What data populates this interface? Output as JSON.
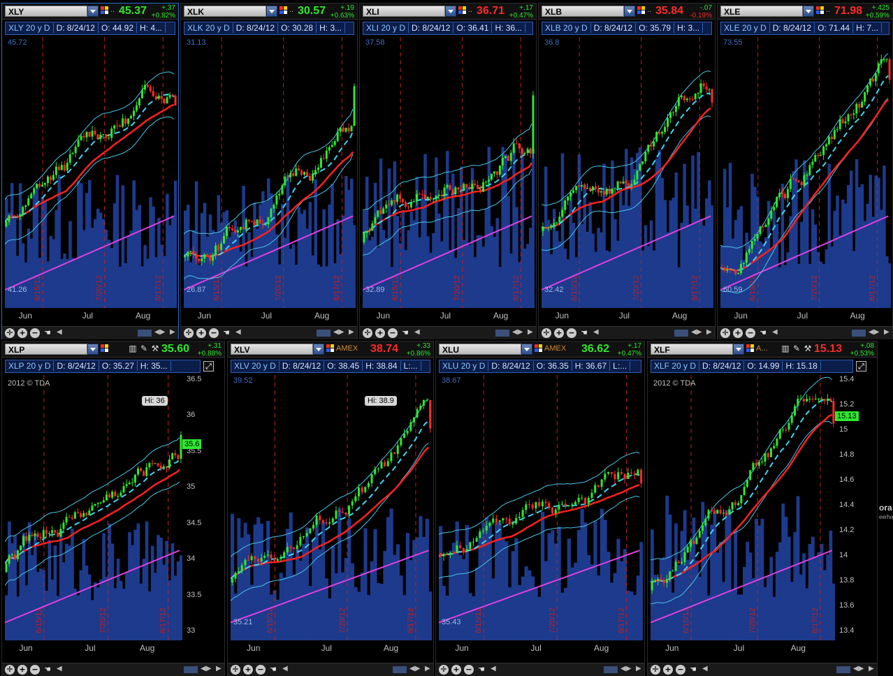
{
  "colors": {
    "up": "#2ee82e",
    "down": "#ff2a2a",
    "bb": "#49c6e6",
    "mid": "#3fd6f0",
    "sma": "#ff2020",
    "long": "#e040e0",
    "vol": "#1d3a8c",
    "grid": "#7a1010"
  },
  "panels": [
    {
      "symbol": "XLY",
      "price": "45.37",
      "chg": "+.37",
      "pct": "+0.82%",
      "dir": "up",
      "study": "XLY 20 y D",
      "d": "D: 8/24/12",
      "o": "O: 44.92",
      "h": "H: 4...",
      "top": "45.72",
      "bottom": "41.26",
      "dates": [
        "6/15/12",
        "7/20/12",
        "8/17/12"
      ],
      "months": [
        "Jun",
        "Jul",
        "Aug"
      ],
      "start": 43.3,
      "end": 45.37,
      "vol": 0.35
    },
    {
      "symbol": "XLK",
      "price": "30.57",
      "chg": "+.19",
      "pct": "+0.63%",
      "dir": "up",
      "study": "XLK 20 y D",
      "d": "D: 8/24/12",
      "o": "O: 30.28",
      "h": "H: 3...",
      "top": "31.13",
      "bottom": "26.87",
      "dates": [
        "6/15/12",
        "7/20/12",
        "8/17/12"
      ],
      "months": [
        "Jun",
        "Jul",
        "Aug"
      ],
      "start": 27.5,
      "end": 30.57,
      "vol": 0.35
    },
    {
      "symbol": "XLI",
      "price": "36.71",
      "chg": "+.17",
      "pct": "+0.47%",
      "dir": "dn",
      "study": "XLI 20 y D",
      "d": "D: 8/24/12",
      "o": "O: 36.41",
      "h": "H: 36...",
      "top": "37.58",
      "bottom": "32.89",
      "dates": [
        "6/15/12",
        "7/20/12",
        "8/17/12"
      ],
      "months": [
        "Jun",
        "Jul",
        "Aug"
      ],
      "start": 34.2,
      "end": 36.71,
      "vol": 0.45
    },
    {
      "symbol": "XLB",
      "price": "35.84",
      "chg": "-.07",
      "pct": "-0.19%",
      "dir": "dn",
      "study": "XLB 20 y D",
      "d": "D: 8/24/12",
      "o": "O: 35.79",
      "h": "H: 3...",
      "top": "36.8",
      "bottom": "32.42",
      "dates": [
        "6/15/12",
        "7/20/12",
        "8/17/12"
      ],
      "months": [
        "Jun",
        "Jul",
        "Aug"
      ],
      "start": 34.0,
      "end": 35.84,
      "vol": 0.45
    },
    {
      "symbol": "XLE",
      "price": "71.98",
      "chg": "+.425",
      "pct": "+0.59%",
      "dir": "dn",
      "study": "XLE 20 y D",
      "d": "D: 8/24/12",
      "o": "O: 71.44",
      "h": "H: 7...",
      "top": "73.55",
      "bottom": "60.59",
      "dates": [
        "6/15/12",
        "7/20/12",
        "8/17/12"
      ],
      "months": [
        "Jun",
        "Jul",
        "Aug"
      ],
      "start": 62.0,
      "end": 71.98,
      "vol": 0.4
    },
    {
      "symbol": "XLP",
      "exch": "",
      "price": "35.60",
      "chg": "+.31",
      "pct": "+0.88%",
      "dir": "up",
      "study": "XLP 20 y D",
      "d": "D: 8/24/12",
      "o": "O: 35.27",
      "h": "H: 35...",
      "copyright": "2012 © TDA",
      "hi": "Hi: 36",
      "tag": "35.6",
      "yticks": [
        "36.5",
        "36",
        "35.5",
        "35",
        "34.5",
        "34",
        "33.5",
        "33"
      ],
      "dates": [
        "6/15/12",
        "7/20/12",
        "8/17/12"
      ],
      "months": [
        "Jun",
        "Jul",
        "Aug"
      ],
      "start": 33.4,
      "end": 35.6,
      "vol": 0.3
    },
    {
      "symbol": "XLV",
      "exch": "AMEX",
      "price": "38.74",
      "chg": "+.33",
      "pct": "+0.86%",
      "dir": "dn",
      "study": "XLV 20 y D",
      "d": "D: 8/24/12",
      "o": "O: 38.45",
      "h": "H: 38.84",
      "l": "L:...",
      "top": "39.52",
      "bottom": "35.21",
      "hi": "Hi: 38.9",
      "dates": [
        "6/15/12",
        "7/20/12",
        "8/17/12"
      ],
      "months": [
        "Jun",
        "Jul",
        "Aug"
      ],
      "start": 35.6,
      "end": 38.74,
      "vol": 0.35
    },
    {
      "symbol": "XLU",
      "exch": "AMEX",
      "price": "36.62",
      "chg": "+.17",
      "pct": "+0.47%",
      "dir": "up",
      "study": "XLU 20 y D",
      "d": "D: 8/24/12",
      "o": "O: 36.35",
      "h": "H: 36.67",
      "l": "L:...",
      "top": "38.67",
      "bottom": "35.43",
      "dates": [
        "6/15/12",
        "7/20/12",
        "8/17/12"
      ],
      "months": [
        "Jun",
        "Jul",
        "Aug"
      ],
      "start": 35.7,
      "end": 36.62,
      "vol": 0.35
    },
    {
      "symbol": "XLF",
      "exch": "A...",
      "price": "15.13",
      "chg": "+.08",
      "pct": "+0.53%",
      "dir": "dn",
      "study": "XLF 20 y D",
      "d": "D: 8/24/12",
      "o": "O: 14.99",
      "h": "H: 15.18",
      "copyright": "2012 © TDA",
      "tag": "15.13",
      "yticks": [
        "15.4",
        "15.2",
        "15",
        "14.8",
        "14.6",
        "14.4",
        "14.2",
        "14",
        "13.8",
        "13.6",
        "13.4"
      ],
      "dates": [
        "6/15/12",
        "7/20/12",
        "8/17/12"
      ],
      "months": [
        "Jun",
        "Jul",
        "Aug"
      ],
      "start": 13.6,
      "end": 15.13,
      "vol": 0.4
    }
  ],
  "side": {
    "label": "ora",
    "sub": "eerhol"
  }
}
